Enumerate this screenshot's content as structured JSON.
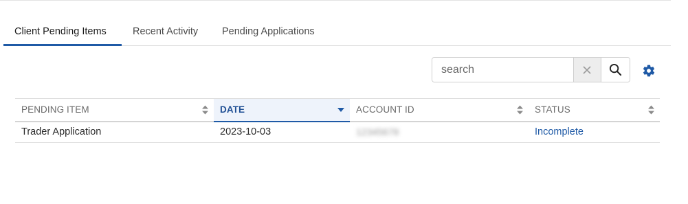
{
  "tabs": [
    {
      "label": "Client Pending Items",
      "active": true
    },
    {
      "label": "Recent Activity",
      "active": false
    },
    {
      "label": "Pending Applications",
      "active": false
    }
  ],
  "search": {
    "placeholder": "search",
    "value": "",
    "clear_icon": "close-icon",
    "submit_icon": "search-icon"
  },
  "settings": {
    "icon": "gear-icon",
    "color": "#1f5aa6"
  },
  "table": {
    "columns": [
      {
        "label": "PENDING ITEM",
        "sort": "none"
      },
      {
        "label": "DATE",
        "sort": "descending"
      },
      {
        "label": "ACCOUNT ID",
        "sort": "none"
      },
      {
        "label": "STATUS",
        "sort": "none"
      }
    ],
    "rows": [
      {
        "pending_item": "Trader Application",
        "date": "2023-10-03",
        "account_id": "12345678",
        "status": "Incomplete"
      }
    ]
  },
  "colors": {
    "accent": "#1f5aa6",
    "link": "#1f5aa6"
  }
}
